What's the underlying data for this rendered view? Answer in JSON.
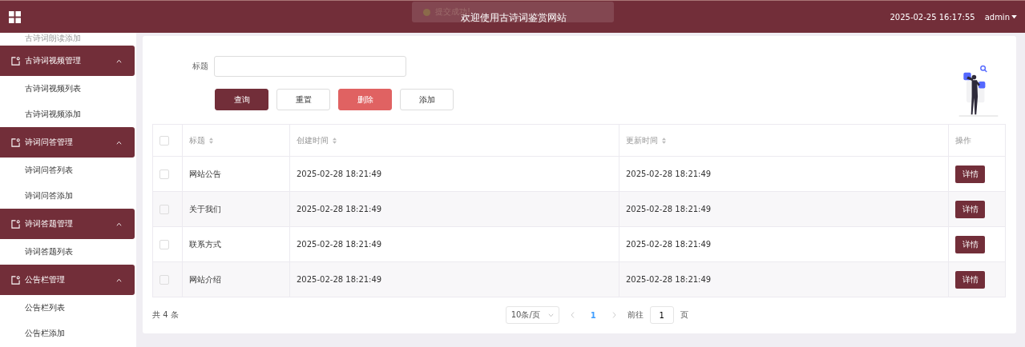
{
  "header": {
    "title": "欢迎使用古诗词鉴赏网站",
    "datetime": "2025-02-25 16:17:55",
    "user": "admin"
  },
  "toast": {
    "message": "提交成功!"
  },
  "sidebar": {
    "items": [
      {
        "kind": "link",
        "label": "古诗词朗读添加"
      },
      {
        "kind": "group",
        "label": "古诗词视频管理",
        "expanded": true,
        "children": [
          {
            "label": "古诗词视频列表"
          },
          {
            "label": "古诗词视频添加"
          }
        ]
      },
      {
        "kind": "group",
        "label": "诗词问答管理",
        "expanded": true,
        "children": [
          {
            "label": "诗词问答列表"
          },
          {
            "label": "诗词问答添加"
          }
        ]
      },
      {
        "kind": "group",
        "label": "诗词答题管理",
        "expanded": true,
        "children": [
          {
            "label": "诗词答题列表"
          }
        ]
      },
      {
        "kind": "group",
        "label": "公告栏管理",
        "expanded": true,
        "children": [
          {
            "label": "公告栏列表"
          },
          {
            "label": "公告栏添加"
          }
        ]
      }
    ]
  },
  "search": {
    "label": "标题"
  },
  "buttons": [
    {
      "label": "查询",
      "kind": "primary"
    },
    {
      "label": "重置",
      "kind": "plain"
    },
    {
      "label": "删除",
      "kind": "danger"
    },
    {
      "label": "添加",
      "kind": "plain"
    }
  ],
  "table": {
    "all_checked": false,
    "columns": [
      "标题",
      "创建时间",
      "更新时间",
      "操作"
    ],
    "rows": [
      {
        "checked": false,
        "title": "网站公告",
        "created": "2025-02-28 18:21:49",
        "updated": "2025-02-28 18:21:49",
        "action": "详情"
      },
      {
        "checked": false,
        "title": "关于我们",
        "created": "2025-02-28 18:21:49",
        "updated": "2025-02-28 18:21:49",
        "action": "详情"
      },
      {
        "checked": false,
        "title": "联系方式",
        "created": "2025-02-28 18:21:49",
        "updated": "2025-02-28 18:21:49",
        "action": "详情"
      },
      {
        "checked": false,
        "title": "网站介绍",
        "created": "2025-02-28 18:21:49",
        "updated": "2025-02-28 18:21:49",
        "action": "详情"
      }
    ]
  },
  "pagination": {
    "total": "共 4 条",
    "page_size": "10条/页",
    "pages": [
      {
        "label": "1",
        "selected": true
      }
    ],
    "goto_label": "前往",
    "goto_value": "1",
    "goto_suffix": "页"
  }
}
